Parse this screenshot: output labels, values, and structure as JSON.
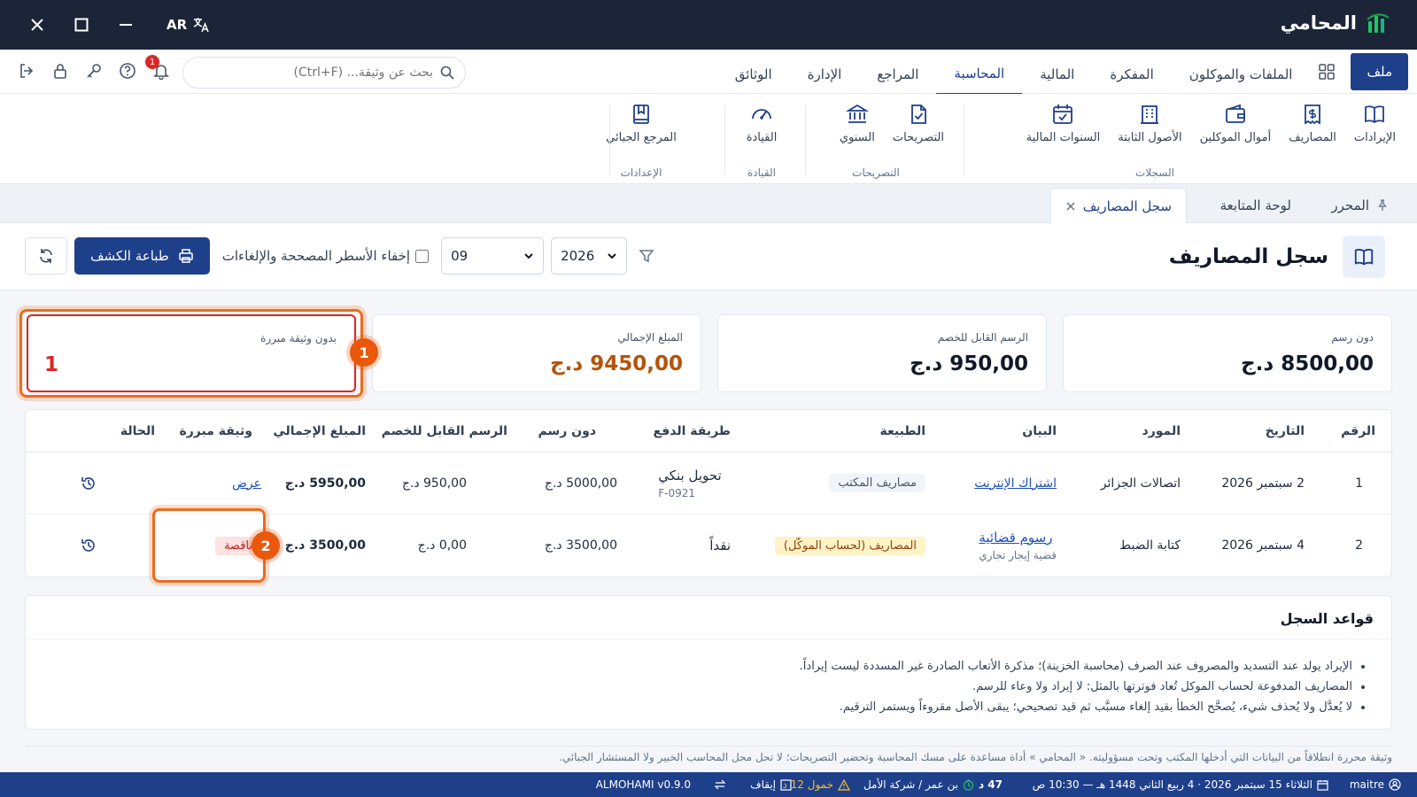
{
  "app": {
    "name": "المحامي",
    "lang": "AR"
  },
  "menu": {
    "file": "ملف",
    "items": [
      "الملفات والموكلون",
      "المفكرة",
      "المالية",
      "المحاسبة",
      "المراجع",
      "الإدارة",
      "الوثائق"
    ],
    "active_index": 3
  },
  "search": {
    "placeholder": "بحث عن وثيقة... (Ctrl+F)"
  },
  "notifications": {
    "count": "1"
  },
  "ribbon": {
    "groups": [
      {
        "label": "السجلات",
        "buttons": [
          {
            "label": "الإيرادات",
            "icon": "book-open-icon"
          },
          {
            "label": "المصاريف",
            "icon": "receipt-dollar-icon"
          },
          {
            "label": "أموال الموكلين",
            "icon": "wallet-icon"
          },
          {
            "label": "الأصول الثابتة",
            "icon": "building-icon"
          },
          {
            "label": "السنوات المالية",
            "icon": "calendar-check-icon"
          }
        ]
      },
      {
        "label": "التصريحات",
        "buttons": [
          {
            "label": "التصريحات",
            "icon": "document-check-icon"
          },
          {
            "label": "السنوي",
            "icon": "bank-icon"
          }
        ]
      },
      {
        "label": "القيادة",
        "buttons": [
          {
            "label": "القيادة",
            "icon": "gauge-icon"
          }
        ]
      },
      {
        "label": "الإعدادات",
        "buttons": [
          {
            "label": "المرجع الجبائي",
            "icon": "bookmark-book-icon"
          }
        ]
      }
    ]
  },
  "tabs": [
    {
      "label": "المحرر",
      "pinned": true
    },
    {
      "label": "لوحة المتابعة"
    },
    {
      "label": "سجل المصاريف",
      "active": true,
      "closable": true
    }
  ],
  "page": {
    "title": "سجل المصاريف",
    "print_label": "طباعة الكشف",
    "hide_label": "إخفاء الأسطر المصححة والإلغاءات",
    "year": "2026",
    "month": "09"
  },
  "cards": [
    {
      "label": "دون رسم",
      "value": "8500,00 د.ج"
    },
    {
      "label": "الرسم القابل للخصم",
      "value": "950,00 د.ج"
    },
    {
      "label": "المبلغ الإجمالي",
      "value": "9450,00 د.ج"
    },
    {
      "label": "بدون وثيقة مبررة",
      "value": "1"
    }
  ],
  "markers": [
    "1",
    "2"
  ],
  "table": {
    "headers": [
      "الرقم",
      "التاريخ",
      "المورد",
      "البيان",
      "الطبيعة",
      "طريقة الدفع",
      "دون رسم",
      "الرسم القابل للخصم",
      "المبلغ الإجمالي",
      "وثيقة مبررة",
      "الحالة"
    ],
    "rows": [
      {
        "num": "1",
        "date": "2 سبتمبر 2026",
        "supplier": "اتصالات الجزائر",
        "desc": "اشتراك الإنترنت",
        "desc_sub": "",
        "nature": "مصاريف المكتب",
        "payment": "تحويل بنكي",
        "payment_ref": "F-0921",
        "ht": "5000,00 د.ج",
        "tax": "950,00 د.ج",
        "total": "5950,00 د.ج",
        "doc": "عرض"
      },
      {
        "num": "2",
        "date": "4 سبتمبر 2026",
        "supplier": "كتابة الضبط",
        "desc": "رسوم قضائية",
        "desc_sub": "قضية إيجار تجاري",
        "nature": "المصاريف (لحساب الموكّل)",
        "payment": "نقداً",
        "payment_ref": "",
        "ht": "3500,00 د.ج",
        "tax": "0,00 د.ج",
        "total": "3500,00 د.ج",
        "doc": "ناقصة"
      }
    ]
  },
  "rules": {
    "title": "قواعد السجل",
    "items": [
      "الإيراد يولد عند التسديد والمصروف عند الصرف (محاسبة الخزينة)؛ مذكرة الأتعاب الصادرة غير المسددة ليست إيراداً.",
      "المصاريف المدفوعة لحساب الموكل تُعاد فوترتها بالمثل: لا إيراد ولا وعاء للرسم.",
      "لا يُعدَّل ولا يُحذف شيء، يُصحَّح الخطأ بقيد إلغاء مسبَّب ثم قيد تصحيحي؛ يبقى الأصل مقروءاً ويستمر الترقيم."
    ]
  },
  "footer_note": "وثيقة محررة انطلاقاً من البيانات التي أدخلها المكتب وتحت مسؤوليته. « المحامي » أداة مساعدة على مسك المحاسبة وتحضير التصريحات؛ لا تحل محل المحاسب الخبير ولا المستشار الجبائي.",
  "status": {
    "user": "maitre",
    "datetime": "الثلاثاء 15 سبتمبر 2026 · 4 ربيع الثاني 1448 هـ — 10:30 ص",
    "firm": "بن عمر / شركة الأمل",
    "amount": "47 د",
    "warn": "خمول 12 د",
    "pause": "إيقاف",
    "version": "ALMOHAMI v0.9.0"
  },
  "colors": {
    "titlebar": "#1c2538",
    "primary": "#1e3f8a",
    "alert": "#dc2626",
    "highlight": "#ea580c",
    "gold": "#b45309"
  }
}
